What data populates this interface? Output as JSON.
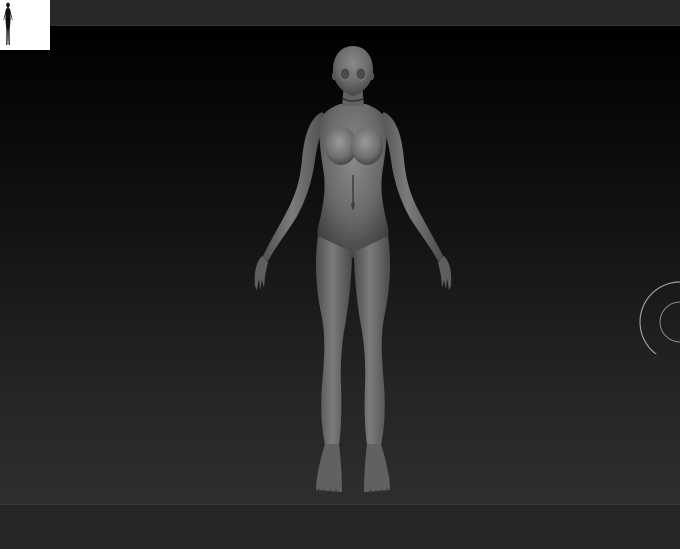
{
  "window": {
    "layout": "3d-sculpting-viewport"
  },
  "icons": {
    "thumbnail": "figure-silhouette-icon",
    "navigation": "rotation-gizmo-icon"
  },
  "colors": {
    "viewport_top": "#000000",
    "viewport_bottom": "#2e2e2e",
    "model_clay": "#6a6a6a",
    "toolbar": "#262626"
  }
}
